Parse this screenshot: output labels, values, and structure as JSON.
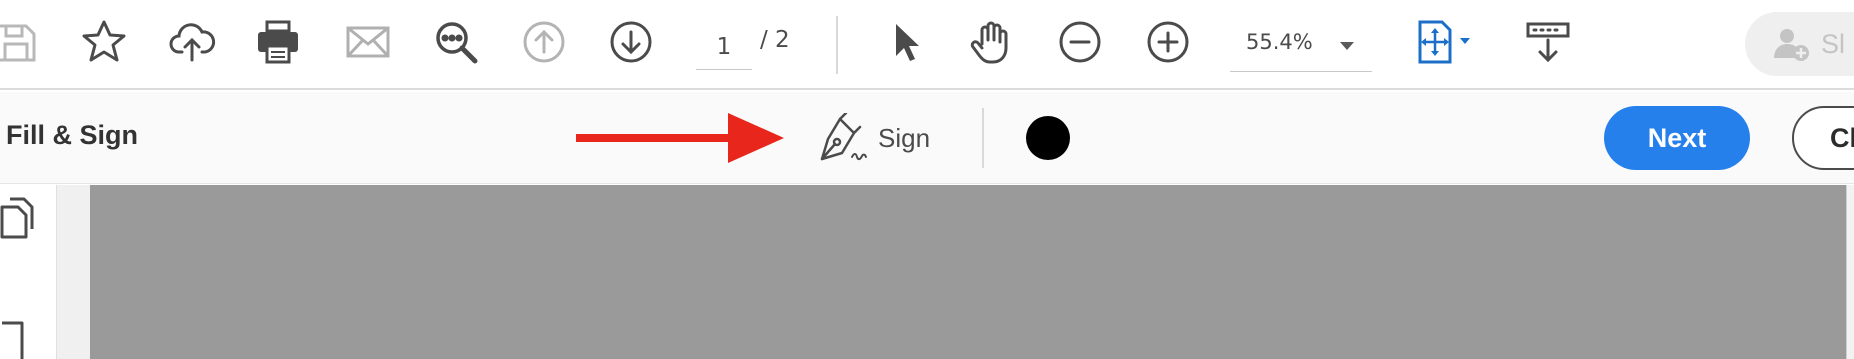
{
  "toolbar": {
    "icons": [
      "save-icon",
      "bookmark-star-icon",
      "upload-cloud-icon",
      "print-icon",
      "email-icon",
      "find-text-icon",
      "page-up-icon",
      "page-down-icon",
      "select-pointer-icon",
      "hand-tool-icon",
      "zoom-out-icon",
      "zoom-in-icon",
      "fit-page-icon",
      "scroll-mode-icon"
    ],
    "page_current": "1",
    "page_total_label": "/  2",
    "zoom_value": "55.4%",
    "share_label": "Sl"
  },
  "fill_sign": {
    "title": "Fill & Sign",
    "sign_label": "Sign",
    "signature_color": "#000000",
    "arrow_color": "#e8261b",
    "next_label": "Next",
    "close_label": "Cl",
    "accent_color": "#2680eb"
  },
  "left_panel": {
    "icons": [
      "page-thumbnails-icon",
      "bookmarks-icon"
    ]
  }
}
